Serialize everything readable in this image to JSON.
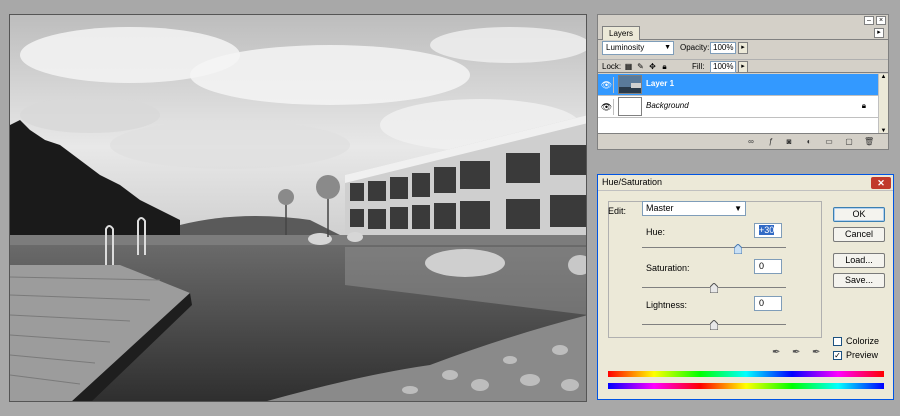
{
  "layers_panel": {
    "tab": "Layers",
    "blend_mode": "Luminosity",
    "opacity_label": "Opacity:",
    "opacity_value": "100%",
    "lock_label": "Lock:",
    "fill_label": "Fill:",
    "fill_value": "100%",
    "layers": [
      {
        "name": "Layer 1",
        "selected": true
      },
      {
        "name": "Background",
        "selected": false,
        "locked": true
      }
    ],
    "footer_icons": [
      "link-icon",
      "fx-icon",
      "mask-icon",
      "adjustment-icon",
      "folder-icon",
      "new-layer-icon",
      "trash-icon"
    ]
  },
  "hue_saturation": {
    "title": "Hue/Saturation",
    "edit_label": "Edit:",
    "edit_value": "Master",
    "hue_label": "Hue:",
    "hue_value": "+30",
    "hue_level": 30,
    "saturation_label": "Saturation:",
    "saturation_value": "0",
    "saturation_level": 0,
    "lightness_label": "Lightness:",
    "lightness_value": "0",
    "lightness_level": 0,
    "buttons": {
      "ok": "OK",
      "cancel": "Cancel",
      "load": "Load...",
      "save": "Save..."
    },
    "colorize_label": "Colorize",
    "colorize_checked": false,
    "preview_label": "Preview",
    "preview_checked": true
  },
  "colors": {
    "selection": "#3399ff",
    "panel": "#d4d0c8",
    "dialog": "#ece9d8",
    "close_button": "#c1392b"
  }
}
